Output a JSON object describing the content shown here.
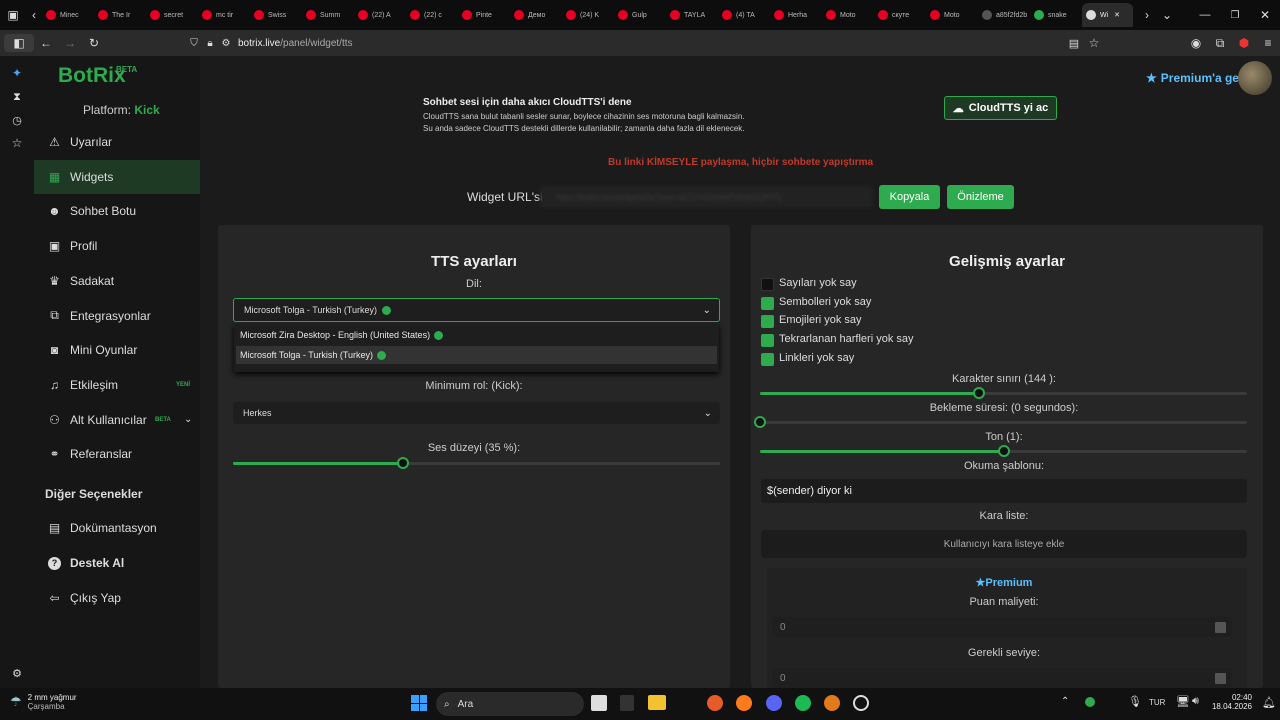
{
  "browser": {
    "tabs": [
      {
        "label": "Minec",
        "color": "#e60023"
      },
      {
        "label": "The Ir",
        "color": "#e60023"
      },
      {
        "label": "secret",
        "color": "#e60023"
      },
      {
        "label": "mc tir",
        "color": "#e60023"
      },
      {
        "label": "Swiss",
        "color": "#e60023"
      },
      {
        "label": "Summ",
        "color": "#e60023"
      },
      {
        "label": "(22) A",
        "color": "#e60023"
      },
      {
        "label": "(22) c",
        "color": "#e60023"
      },
      {
        "label": "Pinte",
        "color": "#e60023"
      },
      {
        "label": "Демо",
        "color": "#e60023"
      },
      {
        "label": "(24) K",
        "color": "#e60023"
      },
      {
        "label": "Gulp",
        "color": "#e60023"
      },
      {
        "label": "TAYLA",
        "color": "#e60023"
      },
      {
        "label": "(4) TA",
        "color": "#e60023"
      },
      {
        "label": "Herha",
        "color": "#e60023"
      },
      {
        "label": "Moto",
        "color": "#e60023"
      },
      {
        "label": "скуте",
        "color": "#e60023"
      },
      {
        "label": "Moto",
        "color": "#e60023"
      },
      {
        "label": "a85f2fd2b",
        "color": "#555555"
      },
      {
        "label": "snake",
        "color": "#2eaa4f"
      },
      {
        "label": "Wi",
        "color": "#dddddd"
      }
    ],
    "url_prefix": "botrix.live",
    "url_path": "/panel/widget/tts"
  },
  "header": {
    "logo": "BotRix",
    "logo_badge": "BETA",
    "premium_label": "Premium'a geç"
  },
  "sidebar": {
    "platform_label": "Platform:",
    "platform_value": "Kick",
    "items": [
      {
        "label": "Uyarılar",
        "icon": "warning-icon"
      },
      {
        "label": "Widgets",
        "icon": "widgets-icon"
      },
      {
        "label": "Sohbet Botu",
        "icon": "robot-icon"
      },
      {
        "label": "Profil",
        "icon": "profile-icon"
      },
      {
        "label": "Sadakat",
        "icon": "trophy-icon"
      },
      {
        "label": "Entegrasyonlar",
        "icon": "integration-icon"
      },
      {
        "label": "Mini Oyunlar",
        "icon": "gamepad-icon"
      },
      {
        "label": "Etkileşim",
        "icon": "music-icon",
        "badge": "YENİ"
      },
      {
        "label": "Alt Kullanıcılar",
        "icon": "users-icon",
        "badge": "BETA"
      },
      {
        "label": "Referanslar",
        "icon": "referral-icon"
      }
    ],
    "other_heading": "Diğer Seçenekler",
    "other_items": [
      {
        "label": "Dokümantasyon",
        "icon": "docs-icon"
      },
      {
        "label": "Destek Al",
        "icon": "help-icon"
      },
      {
        "label": "Çıkış Yap",
        "icon": "logout-icon"
      }
    ]
  },
  "cloudtts": {
    "title": "Sohbet sesi için daha akıcı CloudTTS'i dene",
    "line1": "CloudTTS sana bulut tabanli sesler sunar, boylece cihazinin ses motoruna bagli kalmazsin.",
    "line2": "Su anda sadece CloudTTS destekli dillerde kullanilabilir; zamanla daha fazla dil eklenecek.",
    "button": "CloudTTS yi ac"
  },
  "warning": "Bu linki KİMSEYLE paylaşma, hiçbir sohbete yapıştırma",
  "widget_url": {
    "label": "Widget URL'si:",
    "value": "https://botrix.live/widgets/tts/?pas=sk737mG0dWPyR4pVQP3Ty",
    "copy": "Kopyala",
    "preview": "Önizleme"
  },
  "tts": {
    "title": "TTS ayarları",
    "lang_label": "Dil:",
    "lang_selected": "Microsoft Tolga - Turkish (Turkey)",
    "options": [
      "Microsoft Zira Desktop - English (United States)",
      "Microsoft Tolga - Turkish (Turkey)"
    ],
    "min_role_label": "Minimum rol: (Kick):",
    "min_role_value": "Herkes",
    "volume_label": "Ses düzeyi (35 %):",
    "volume": 35
  },
  "advanced": {
    "title": "Gelişmiş ayarlar",
    "checks": [
      {
        "label": "Sayıları yok say",
        "checked": false
      },
      {
        "label": "Sembolleri yok say",
        "checked": true
      },
      {
        "label": "Emojileri yok say",
        "checked": true
      },
      {
        "label": "Tekrarlanan harfleri yok say",
        "checked": true
      },
      {
        "label": "Linkleri yok say",
        "checked": true
      }
    ],
    "char_limit_label": "Karakter sınırı (144 ):",
    "char_limit_fraction": 0.45,
    "cooldown_label": "Bekleme süresi: (0 segundos):",
    "cooldown_fraction": 0,
    "pitch_label": "Ton (1):",
    "pitch_fraction": 0.5,
    "template_label": "Okuma şablonu:",
    "template_value": "$(sender) diyor ki",
    "blacklist_label": "Kara liste:",
    "blacklist_placeholder": "Kullanıcıyı kara listeye ekle",
    "premium_title": "Premium",
    "cost_label": "Puan maliyeti:",
    "cost_value": "0",
    "level_label": "Gerekli seviye:",
    "level_value": "0"
  },
  "taskbar": {
    "weather": "2 mm yağmur",
    "weather_day": "Çarşamba",
    "search": "Ara",
    "lang": "TUR",
    "time": "02:40",
    "date": "18.04.2026"
  },
  "colors": {
    "accent": "#2eaa4f",
    "warning": "#c0392b",
    "bg": "#1b1b1b"
  }
}
